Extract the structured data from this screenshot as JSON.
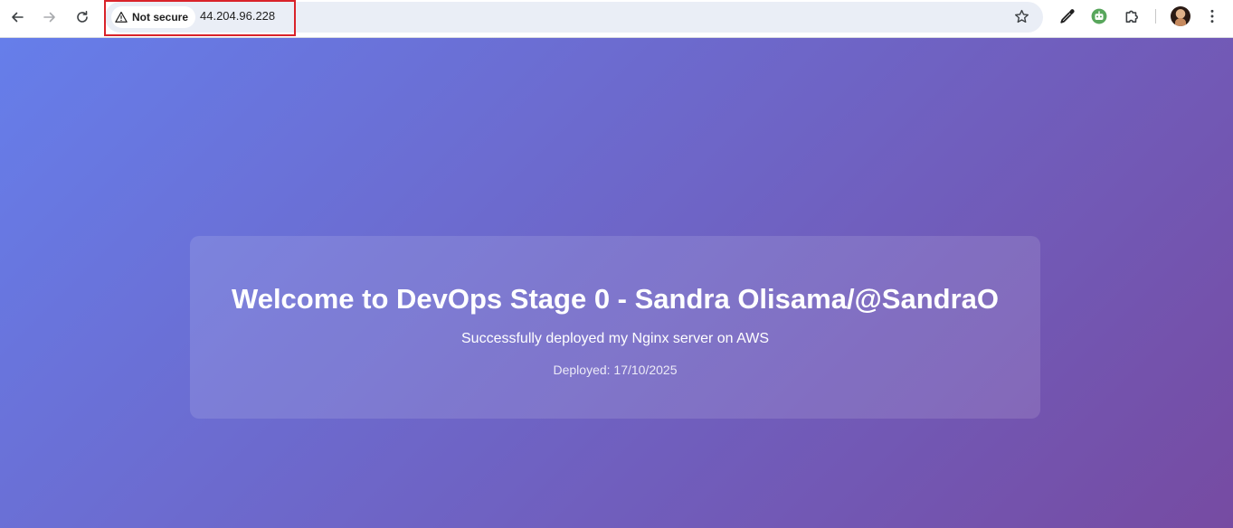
{
  "browser": {
    "security_label": "Not secure",
    "url": "44.204.96.228",
    "icons": {
      "back": "back-arrow-icon",
      "forward": "forward-arrow-icon",
      "reload": "reload-icon",
      "warning": "warning-triangle-icon",
      "bookmark": "star-icon",
      "eyedropper": "eyedropper-icon",
      "extension_bot": "robot-extension-icon",
      "extensions": "puzzle-icon",
      "menu": "kebab-menu-icon"
    },
    "highlight_color": "#d9232a"
  },
  "page": {
    "title": "Welcome to DevOps Stage 0 - Sandra Olisama/@SandraO",
    "subtitle": "Successfully deployed my Nginx server on AWS",
    "deployed": "Deployed: 17/10/2025",
    "gradient_start": "#667eea",
    "gradient_end": "#764ba2"
  }
}
